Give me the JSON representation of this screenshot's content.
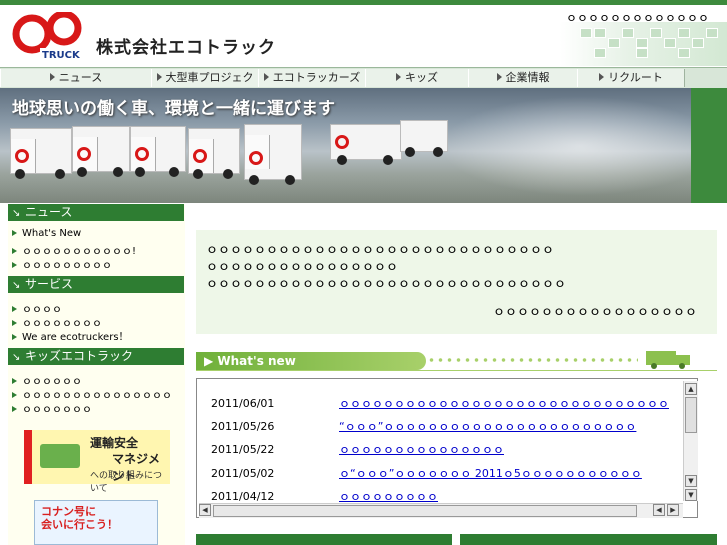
{
  "header": {
    "top_link": "ｏｏｏｏｏｏｏｏｏｏｏｏｏ",
    "company_name": "株式会社エコトラック",
    "logo_text": "TRUCK"
  },
  "nav": {
    "items": [
      {
        "label": "ニュース"
      },
      {
        "label": "大型車プロジェクト"
      },
      {
        "label": "エコトラッカーズ"
      },
      {
        "label": "キッズ"
      },
      {
        "label": "企業情報"
      },
      {
        "label": "リクルート"
      }
    ]
  },
  "banner": {
    "caption": "地球思いの働く車、環境と一緒に運びます"
  },
  "sidebar": {
    "news": {
      "title": "ニュース",
      "items": [
        "What's New",
        "ｏｏｏｏｏｏｏｏｏｏｏ!",
        "ｏｏｏｏｏｏｏｏｏ"
      ]
    },
    "service": {
      "title": "サービス",
      "items": [
        "ｏｏｏｏ",
        "ｏｏｏｏｏｏｏｏ",
        "We are ecotruckers！"
      ]
    },
    "kids": {
      "title": "キッズエコトラック",
      "items": [
        "ｏｏｏｏｏｏ",
        "ｏｏｏｏｏｏｏｏｏｏｏｏｏｏｏ",
        "ｏｏｏｏｏｏｏ"
      ]
    },
    "promo": {
      "line1": "運輸安全",
      "line2": "マネジメント",
      "line3": "への取り組みについて"
    },
    "conan": {
      "line1": "コナン号に",
      "line2": "会いに行こう！"
    }
  },
  "content": {
    "lines": [
      "ｏｏｏｏｏｏｏｏｏｏｏｏｏｏｏｏｏｏｏｏｏｏｏｏｏｏｏｏｏ",
      "ｏｏｏｏｏｏｏｏｏｏｏｏｏｏｏｏ",
      "ｏｏｏｏｏｏｏｏｏｏｏｏｏｏｏｏｏｏｏｏｏｏｏｏｏｏｏｏｏｏ"
    ],
    "signature": "ｏｏｏｏｏｏｏｏｏｏｏｏｏｏｏｏｏ"
  },
  "whats_new": {
    "title": "What's new",
    "rows": [
      {
        "date": "2011/06/01",
        "text": "ｏｏｏｏｏｏｏｏｏｏｏｏｏｏｏｏｏｏｏｏｏｏｏｏｏｏｏｏｏｏ"
      },
      {
        "date": "2011/05/26",
        "text": "“ｏｏｏ”ｏｏｏｏｏｏｏｏｏｏｏｏｏｏｏｏｏｏｏｏｏｏｏ"
      },
      {
        "date": "2011/05/22",
        "text": "ｏｏｏｏｏｏｏｏｏｏｏｏｏｏｏ"
      },
      {
        "date": "2011/05/02",
        "text": "ｏ“ｏｏｏ”ｏｏｏｏｏｏｏ 2011ｏ5ｏｏｏｏｏｏｏｏｏｏｏ"
      },
      {
        "date": "2011/04/12",
        "text": "ｏｏｏｏｏｏｏｏｏ"
      }
    ]
  },
  "colors": {
    "brand_green": "#2e7d32",
    "logo_red": "#d81818",
    "link_blue": "#0000cc"
  }
}
